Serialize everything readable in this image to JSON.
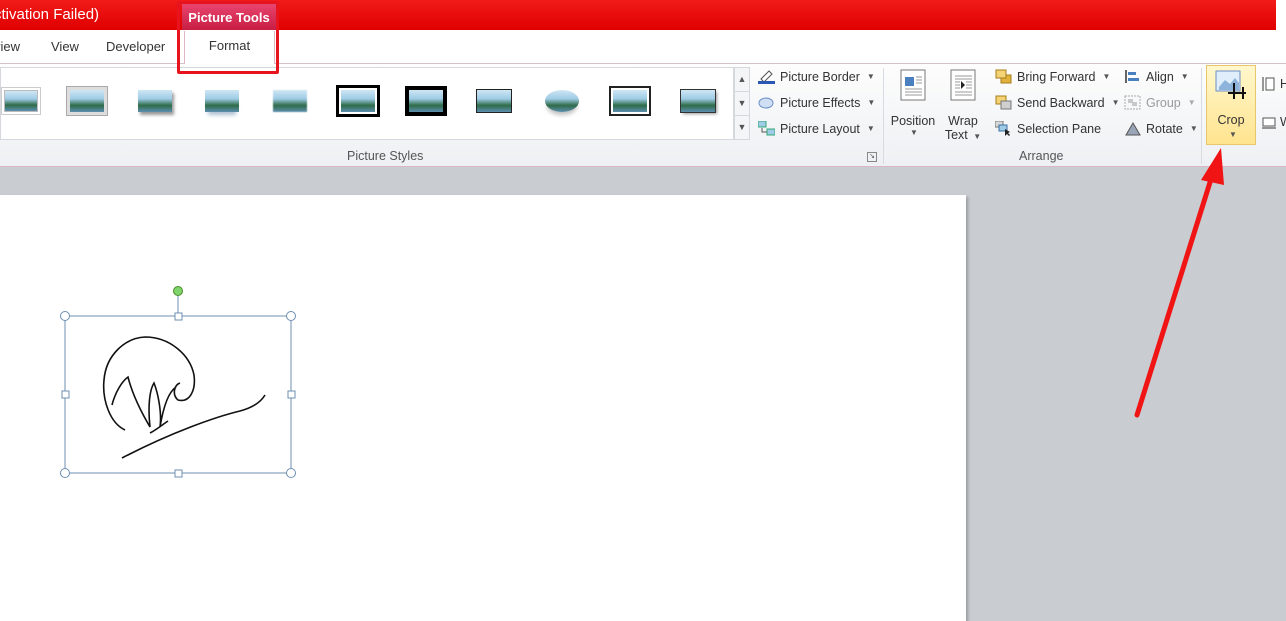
{
  "title_bar": {
    "title": "ctivation Failed)"
  },
  "contextual_tab": {
    "label": "Picture Tools"
  },
  "tabs": [
    {
      "label": "view"
    },
    {
      "label": "View"
    },
    {
      "label": "Developer"
    },
    {
      "label": "Format"
    }
  ],
  "picture_styles": {
    "commands": {
      "border": "Picture Border",
      "effects": "Picture Effects",
      "layout": "Picture Layout"
    },
    "group_label": "Picture Styles"
  },
  "arrange": {
    "position": "Position",
    "wrap_text_line1": "Wrap",
    "wrap_text_line2": "Text",
    "bring_forward": "Bring Forward",
    "send_backward": "Send Backward",
    "selection_pane": "Selection Pane",
    "align": "Align",
    "group": "Group",
    "rotate": "Rotate",
    "group_label": "Arrange"
  },
  "size": {
    "crop": "Crop"
  },
  "colors": {
    "title_bar": "#e00000",
    "contextual_tab": "#c81d43",
    "highlight": "#e8141d",
    "arrow": "#f01414",
    "crop_active": "#ffe48f"
  }
}
